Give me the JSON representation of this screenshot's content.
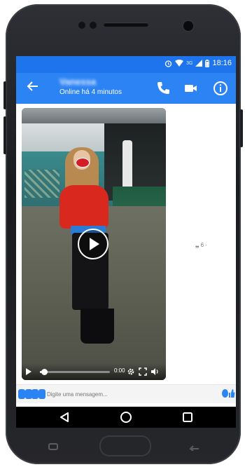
{
  "status_bar": {
    "time": "18:16",
    "network": "3G",
    "icons": [
      "alarm-icon",
      "wifi-icon",
      "signal-icon",
      "battery-icon"
    ]
  },
  "header": {
    "contact_name": "Vanessa",
    "contact_status": "Online há 4 minutos",
    "actions": [
      "phone-icon",
      "video-call-icon",
      "info-icon"
    ]
  },
  "video_message": {
    "elapsed": "0:00",
    "progress": 0.02,
    "controls": [
      "play-icon",
      "settings-icon",
      "fullscreen-icon",
      "volume-icon"
    ]
  },
  "side_indicator": "❠ 6 ·",
  "composer": {
    "placeholder": "Digite uma mensagem...",
    "left_icons": [
      "more-icon",
      "camera-icon",
      "gallery-icon",
      "mic-icon"
    ],
    "right_icons": [
      "emoji-icon",
      "like-icon"
    ]
  },
  "nav_bar": [
    "back-icon",
    "home-icon",
    "recents-icon"
  ],
  "colors": {
    "statusbar": "#1e74ec",
    "appbar": "#2c83f4",
    "accent": "#2c83f4"
  }
}
